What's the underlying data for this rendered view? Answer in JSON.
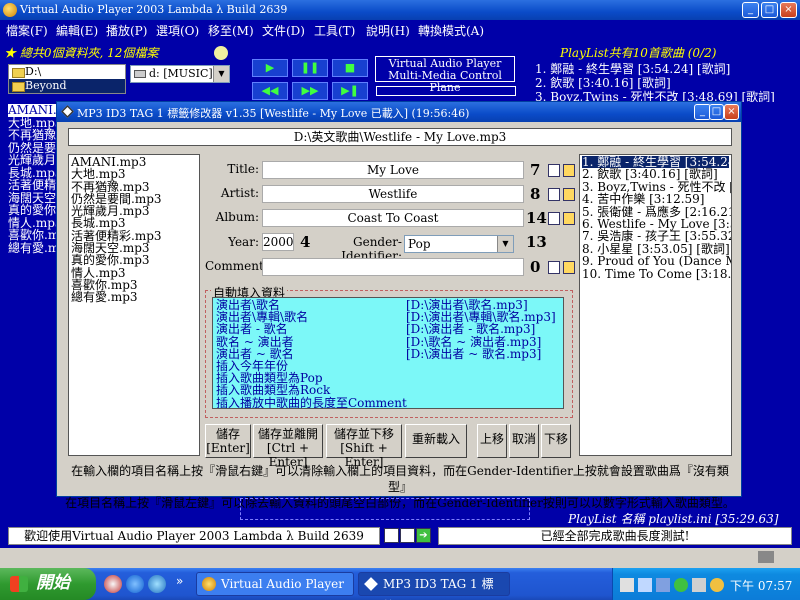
{
  "window": {
    "title": "Virtual Audio Player 2003 Lambda λ  Build 2639",
    "min": "_",
    "max": "□",
    "close": "×"
  },
  "menu": [
    "檔案(F)",
    "編輯(E)",
    "播放(P)",
    "選項(O)",
    "移至(M)",
    "文件(D)",
    "工具(T)",
    "說明(H)",
    "轉換模式(A)"
  ],
  "left_panel": {
    "summary": "總共0個資料夾, 12個檔案",
    "folders": [
      "D:\\",
      "Beyond"
    ],
    "drive": "d: [MUSIC]",
    "under_list": [
      "AMANI.mp3",
      "大地.mp3",
      "不再猶豫",
      "仍然是要",
      "光輝歲月",
      "長城.mp3",
      "活著便精",
      "海闊天空",
      "真的愛你",
      "情人.mp3",
      "喜歡你.m",
      "總有愛.m"
    ]
  },
  "controls": {
    "row1": [
      "▶",
      "❚❚",
      "■"
    ],
    "row2": [
      "◀◀",
      "▶▶",
      "▶❚"
    ],
    "vap_line1": "Virtual Audio Player",
    "vap_line2": "Multi-Media Control Plane"
  },
  "playlist": {
    "header": "PlayList共有10首歌曲 (0/2)",
    "items_top": [
      "1. 鄭融 - 終生學習 [3:54.24] [歌詞]",
      "2. 飲歌 [3:40.16] [歌詞]",
      "3. Boyz,Twins - 死性不改 [3:48.69] [歌詞]"
    ],
    "name": "PlayList 名稱 playlist.ini [35:29.63]"
  },
  "dialog": {
    "title": "MP3 ID3 TAG 1 標籤修改器 v1.35 [Westlife - My Love 已載入] (19:56:46)",
    "path": "D:\\英文歌曲\\Westlife - My Love.mp3",
    "files": [
      "AMANI.mp3",
      "大地.mp3",
      "不再猶豫.mp3",
      "仍然是要間.mp3",
      "光輝歲月.mp3",
      "長城.mp3",
      "活著便精彩.mp3",
      "海闊天空.mp3",
      "真的愛你.mp3",
      "情人.mp3",
      "喜歡你.mp3",
      "總有愛.mp3"
    ],
    "labels": {
      "title": "Title:",
      "artist": "Artist:",
      "album": "Album:",
      "year": "Year:",
      "gender": "Gender-Identifier:",
      "comment": "Comment:"
    },
    "values": {
      "title": "My Love",
      "artist": "Westlife",
      "album": "Coast To Coast",
      "year": "2000",
      "gender": "Pop",
      "comment": ""
    },
    "counts": {
      "title": "7",
      "artist": "8",
      "album": "14",
      "year": "4",
      "gender": "13",
      "comment": "0"
    },
    "auto_group_label": "自動填入資料",
    "auto_items": [
      {
        "l": "演出者\\歌名",
        "r": "[D:\\演出者\\歌名.mp3]"
      },
      {
        "l": "演出者\\專輯\\歌名",
        "r": "[D:\\演出者\\專輯\\歌名.mp3]"
      },
      {
        "l": "演出者 - 歌名",
        "r": "[D:\\演出者 - 歌名.mp3]"
      },
      {
        "l": "歌名 ~ 演出者",
        "r": "[D:\\歌名 ~ 演出者.mp3]"
      },
      {
        "l": "演出者 ~ 歌名",
        "r": "[D:\\演出者 ~ 歌名.mp3]"
      },
      {
        "l": "插入今年年份",
        "r": ""
      },
      {
        "l": "插入歌曲類型為Pop",
        "r": ""
      },
      {
        "l": "插入歌曲類型為Rock",
        "r": ""
      },
      {
        "l": "插入播放中歌曲的長度至Comment",
        "r": ""
      }
    ],
    "buttons": {
      "save_a": "儲存",
      "save_b": "[Enter]",
      "save_close_a": "儲存並離開",
      "save_close_b": "[Ctrl + Enter]",
      "save_next_a": "儲存並下移",
      "save_next_b": "[Shift + Enter]",
      "reload": "重新載入",
      "up": "上移",
      "cancel": "取消",
      "down": "下移"
    },
    "right_list": [
      "1. 鄭融 - 終生學習 [3:54.24] [",
      "2. 飲歌 [3:40.16] [歌詞]",
      "3. Boyz,Twins - 死性不改 [3:4",
      "4. 苦中作樂 [3:12.59]",
      "5. 張衛健 - 爲應多 [2:16.21]",
      "6. Westlife - My Love [3:57.56]",
      "7. 吳浩康 - 孩子王 [3:55.32] [",
      "8. 小星星 [3:53.05] [歌詞]",
      "9. Proud of You (Dance Mix) [3",
      "10. Time To Come [3:18.39]"
    ],
    "help1": "在輸入欄的項目名稱上按『滑鼠右鍵』可以清除輸入欄上的項目資料，而在Gender-Identifier上按就會設置歌曲爲『沒有類型』",
    "help2": "在項目名稱上按『滑鼠左鍵』可以除去輸入資料的頭尾空白部份，而在Gender-Identifier按則可以以數字形式輸入歌曲類型。"
  },
  "status": {
    "left": "歡迎使用Virtual Audio Player 2003 Lambda λ  Build 2639",
    "right": "已經全部完成歌曲長度測試!"
  },
  "taskbar": {
    "start": "開始",
    "task1": "Virtual Audio Player 2...",
    "task2": "MP3 ID3 TAG 1 標籤...",
    "clock": "下午 07:57"
  }
}
